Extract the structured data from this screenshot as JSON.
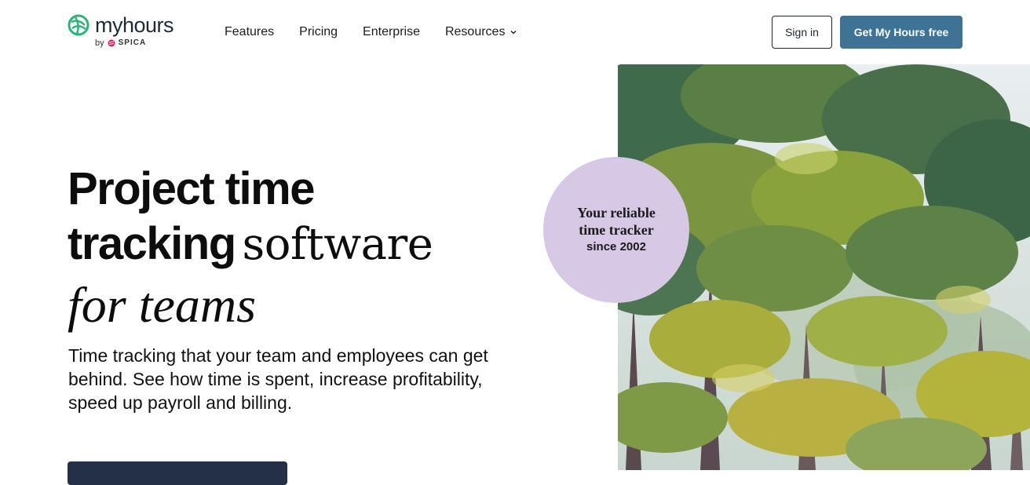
{
  "header": {
    "logo": {
      "word_regular": "my",
      "word_bold": "hours",
      "by": "by",
      "spica": "SPICA"
    },
    "nav": [
      {
        "label": "Features"
      },
      {
        "label": "Pricing"
      },
      {
        "label": "Enterprise"
      },
      {
        "label": "Resources",
        "has_dropdown": true
      }
    ],
    "signin_label": "Sign in",
    "cta_label": "Get My Hours free"
  },
  "hero": {
    "title_line1": "Project time",
    "title_line2_bold": "tracking",
    "title_line2_serif": "software",
    "title_line3": "for teams",
    "subtitle": "Time tracking that your team and employees can get behind. See how time is spent, increase profitability, speed up payroll and billing."
  },
  "badge": {
    "line1": "Your reliable",
    "line2": "time tracker",
    "line3": "since 2002"
  },
  "colors": {
    "primary_button": "#3f7396",
    "badge_bg": "#d7c8e6",
    "logo_green": "#2fb37b",
    "spica_pink": "#d6245c"
  },
  "icons": {
    "logo": "myhours-logo-icon",
    "spica": "spica-logo-icon",
    "dropdown": "chevron-down-icon"
  }
}
